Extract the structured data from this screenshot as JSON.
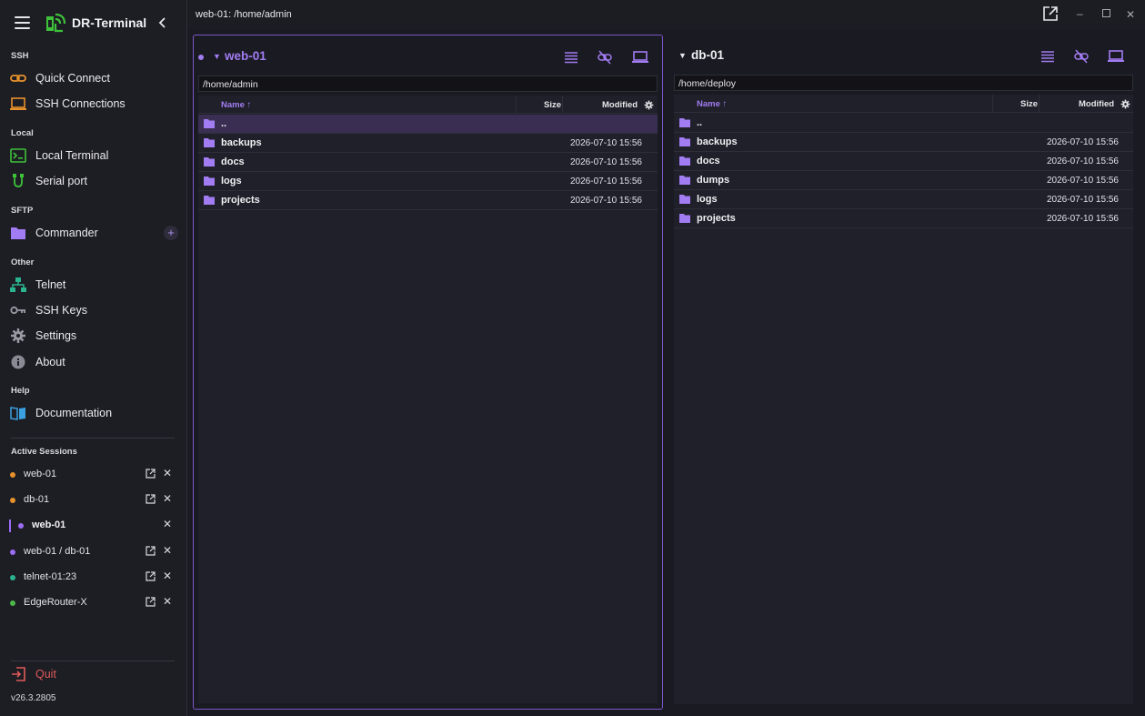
{
  "app": {
    "name": "DR-Terminal",
    "version": "v26.3.2805"
  },
  "colors": {
    "accent": "#9b6cf5",
    "brand_green": "#3ec23a",
    "quit_red": "#e05a5a",
    "session_orange": "#e8922b",
    "session_teal": "#2bb38f",
    "session_green": "#4cb848"
  },
  "sidebar": {
    "sections": {
      "ssh": "SSH",
      "local": "Local",
      "sftp": "SFTP",
      "other": "Other",
      "help": "Help",
      "active_sessions": "Active Sessions"
    },
    "items": {
      "quick_connect": "Quick Connect",
      "ssh_connections": "SSH Connections",
      "local_terminal": "Local Terminal",
      "serial_port": "Serial port",
      "commander": "Commander",
      "telnet": "Telnet",
      "ssh_keys": "SSH Keys",
      "settings": "Settings",
      "about": "About",
      "documentation": "Documentation"
    },
    "sessions": [
      {
        "name": "web-01",
        "color": "#e8922b"
      },
      {
        "name": "db-01",
        "color": "#e8922b"
      },
      {
        "name": "web-01",
        "color": "#9b6cf5"
      },
      {
        "name": "web-01 / db-01",
        "color": "#9b6cf5"
      },
      {
        "name": "telnet-01:23",
        "color": "#2bb38f"
      },
      {
        "name": "EdgeRouter-X",
        "color": "#4cb848"
      }
    ],
    "quit": "Quit"
  },
  "titlebar": {
    "title": "web-01: /home/admin"
  },
  "panes": {
    "left": {
      "host": "web-01",
      "path": "/home/admin",
      "columns": {
        "name": "Name ↑",
        "size": "Size",
        "modified": "Modified"
      },
      "rows": [
        {
          "name": "..",
          "modified": ""
        },
        {
          "name": "backups",
          "modified": "2026-07-10 15:56"
        },
        {
          "name": "docs",
          "modified": "2026-07-10 15:56"
        },
        {
          "name": "logs",
          "modified": "2026-07-10 15:56"
        },
        {
          "name": "projects",
          "modified": "2026-07-10 15:56"
        }
      ]
    },
    "right": {
      "host": "db-01",
      "path": "/home/deploy",
      "columns": {
        "name": "Name ↑",
        "size": "Size",
        "modified": "Modified"
      },
      "rows": [
        {
          "name": "..",
          "modified": ""
        },
        {
          "name": "backups",
          "modified": "2026-07-10 15:56"
        },
        {
          "name": "docs",
          "modified": "2026-07-10 15:56"
        },
        {
          "name": "dumps",
          "modified": "2026-07-10 15:56"
        },
        {
          "name": "logs",
          "modified": "2026-07-10 15:56"
        },
        {
          "name": "projects",
          "modified": "2026-07-10 15:56"
        }
      ]
    }
  }
}
